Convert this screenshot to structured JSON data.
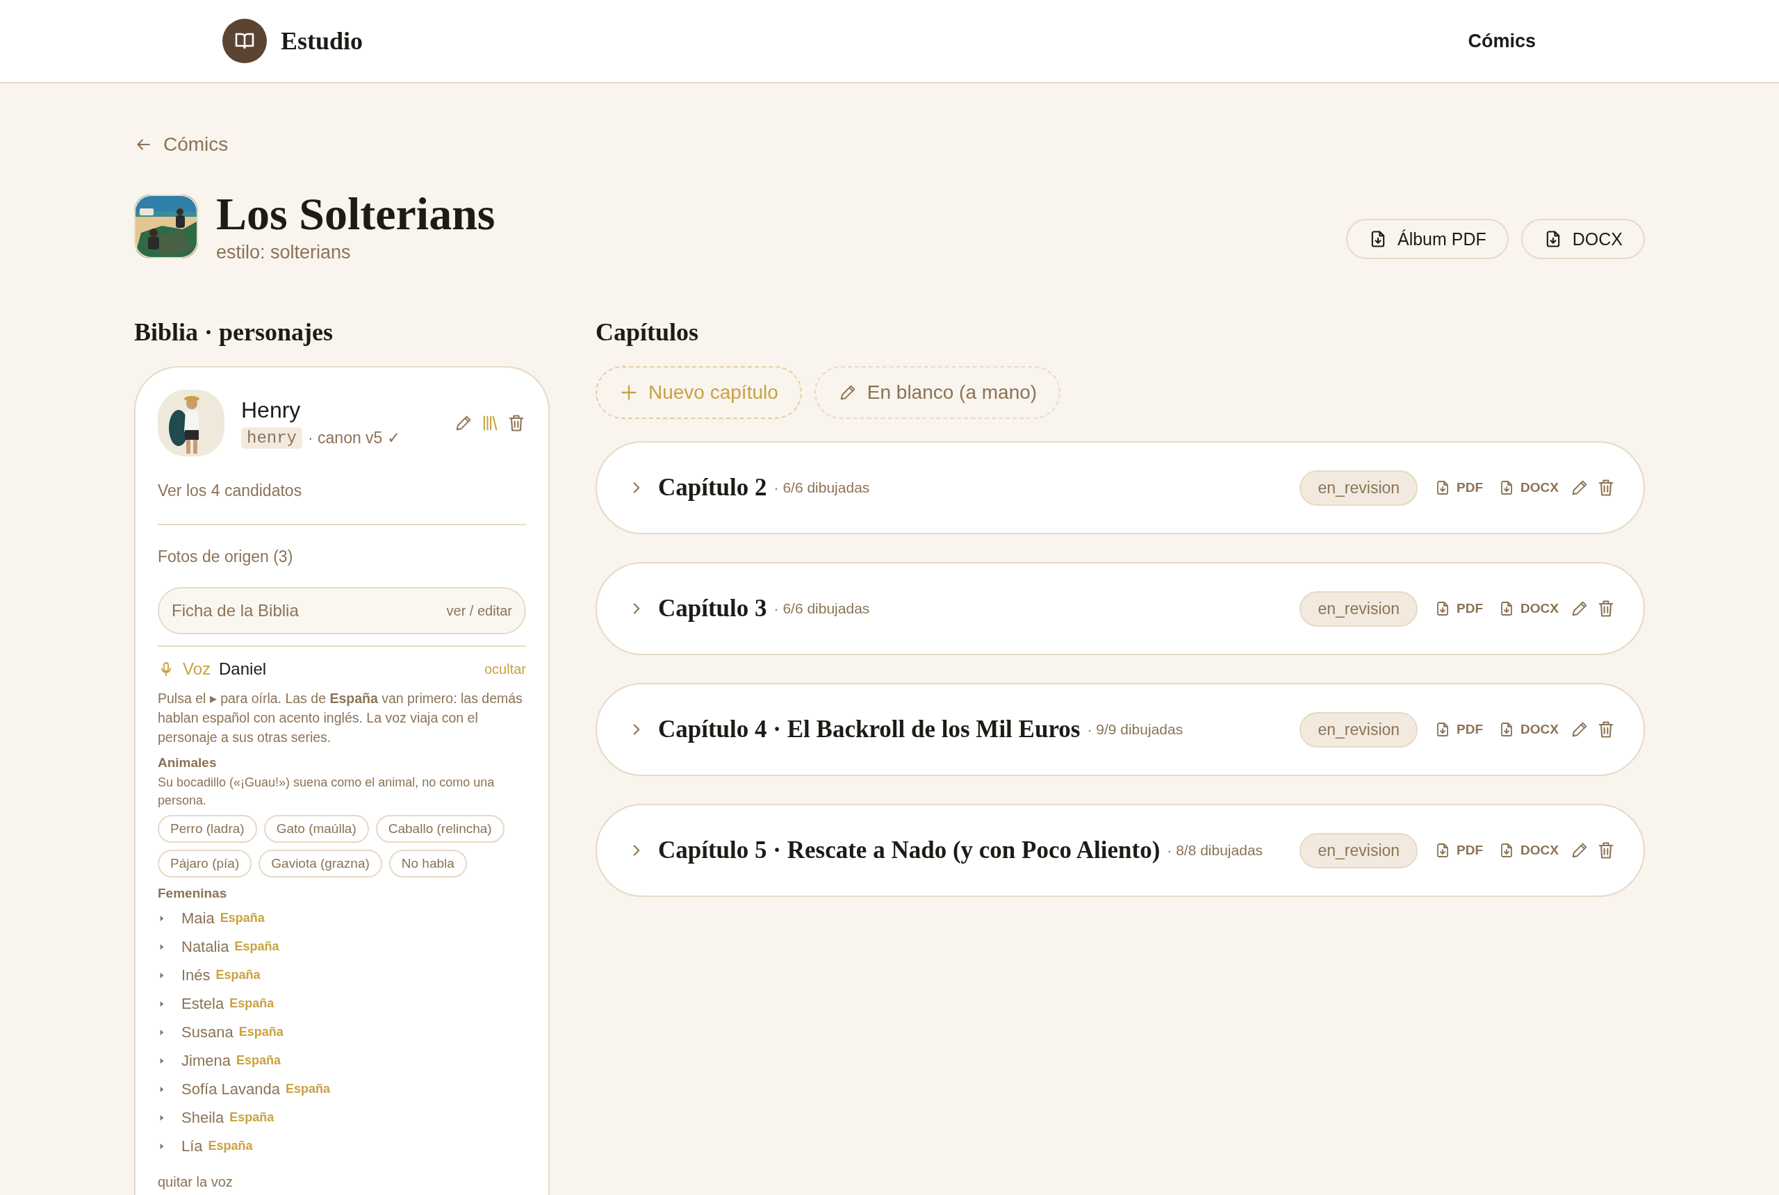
{
  "header": {
    "brand": "Estudio",
    "nav": "Cómics"
  },
  "back_link": "Cómics",
  "comic": {
    "title": "Los Solterians",
    "subtitle": "estilo: solterians"
  },
  "exports": [
    "Álbum PDF",
    "DOCX"
  ],
  "bible": {
    "heading": "Biblia · personajes",
    "character": {
      "name": "Henry",
      "slug": "henry",
      "canon": "· canon v5 ✓",
      "candidates_link": "Ver los 4 candidatos",
      "photos": "Fotos de origen (3)",
      "sheet": {
        "label": "Ficha de la Biblia",
        "action": "ver / editar"
      },
      "voice": {
        "label": "Voz",
        "name": "Daniel",
        "hide": "ocultar",
        "help": "Pulsa el ▸ para oírla. Las de **España** van primero: las demás hablan español con acento inglés. La voz viaja con el personaje a sus otras series.",
        "animals": {
          "heading": "Animales",
          "note": "Su bocadillo («¡Guau!») suena como el animal, no como una persona.",
          "options": [
            "Perro (ladra)",
            "Gato (maúlla)",
            "Caballo (relincha)",
            "Pájaro (pía)",
            "Gaviota (grazna)",
            "No habla"
          ]
        },
        "female": {
          "heading": "Femeninas",
          "voices": [
            {
              "name": "Maia",
              "accent": "España"
            },
            {
              "name": "Natalia",
              "accent": "España"
            },
            {
              "name": "Inés",
              "accent": "España"
            },
            {
              "name": "Estela",
              "accent": "España"
            },
            {
              "name": "Susana",
              "accent": "España"
            },
            {
              "name": "Jimena",
              "accent": "España"
            },
            {
              "name": "Sofía Lavanda",
              "accent": "España"
            },
            {
              "name": "Sheila",
              "accent": "España"
            },
            {
              "name": "Lía",
              "accent": "España"
            }
          ]
        },
        "remove": "quitar la voz"
      }
    }
  },
  "chapters": {
    "heading": "Capítulos",
    "new_button": "Nuevo capítulo",
    "blank_button": "En blanco (a mano)",
    "items": [
      {
        "title": "Capítulo 2",
        "count": "· 6/6 dibujadas",
        "status": "en_revision",
        "pdf": "PDF",
        "docx": "DOCX"
      },
      {
        "title": "Capítulo 3",
        "count": "· 6/6 dibujadas",
        "status": "en_revision",
        "pdf": "PDF",
        "docx": "DOCX"
      },
      {
        "title": "Capítulo 4 · El Backroll de los Mil Euros",
        "count": "· 9/9 dibujadas",
        "status": "en_revision",
        "pdf": "PDF",
        "docx": "DOCX"
      },
      {
        "title": "Capítulo 5 · Rescate a Nado (y con Poco Aliento)",
        "count": "· 8/8 dibujadas",
        "status": "en_revision",
        "pdf": "PDF",
        "docx": "DOCX"
      }
    ]
  }
}
